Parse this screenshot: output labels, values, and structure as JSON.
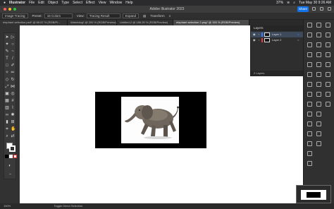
{
  "menubar": {
    "apple": "",
    "app": "Illustrator",
    "items": [
      "File",
      "Edit",
      "Object",
      "Type",
      "Select",
      "Effect",
      "View",
      "Window",
      "Help"
    ],
    "battery": "37%",
    "datetime": "Tue May 30  9:26 AM"
  },
  "titlebar": {
    "title": "Adobe Illustrator 2023",
    "share": "Share"
  },
  "controlbar": {
    "image_tracing": "Image Tracing",
    "preset": "Preset:",
    "preset_value": "16 Colors",
    "view": "View:",
    "view_value": "Tracing Result",
    "expand": "Expand",
    "transform": "Transform"
  },
  "tabs": [
    "elephant selection.psd* @ 66.67 % (RGB/Pr...",
    "Watchdog* @ 200 % (RGB/Preview)",
    "Untitled-2 @ 186.26 % (RGB/Preview)",
    "elephant selection 2.png* @ 150 % (RGB/Preview)"
  ],
  "layers": {
    "title": "Layers",
    "items": [
      "Layer 1",
      "Layer 2"
    ],
    "count": "2 Layers"
  },
  "status": {
    "zoom": "150%",
    "tool": "Toggle Direct Selection"
  },
  "colors": {
    "accent": "#1473e6",
    "layer1": "#3d7bff",
    "layer2": "#e04040"
  }
}
